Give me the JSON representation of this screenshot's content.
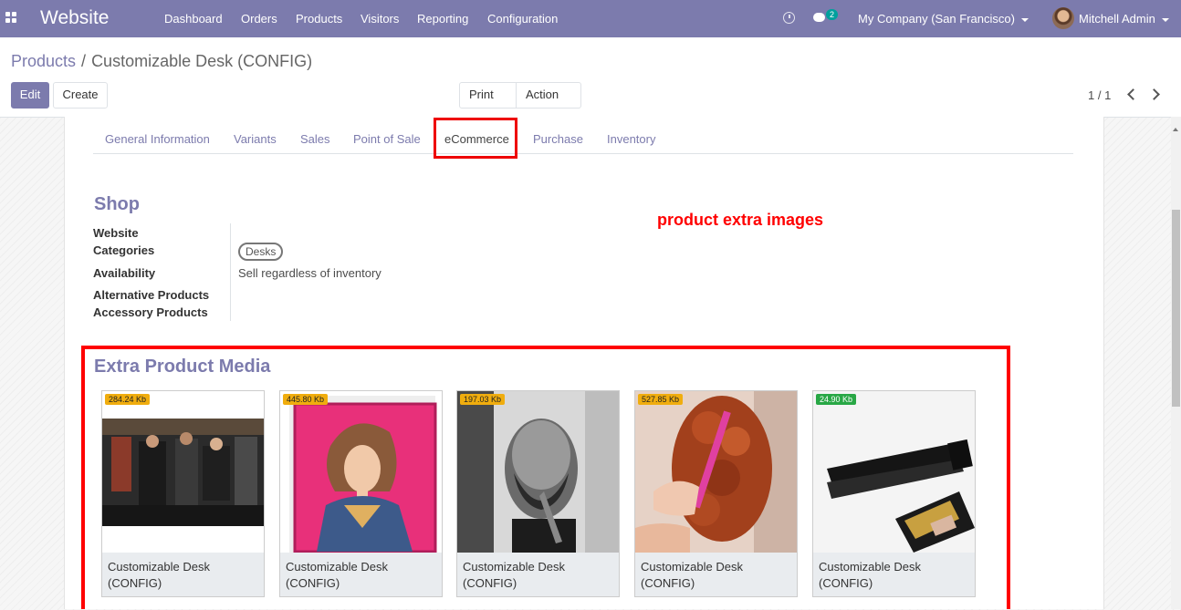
{
  "navbar": {
    "brand": "Website",
    "menu": [
      "Dashboard",
      "Orders",
      "Products",
      "Visitors",
      "Reporting",
      "Configuration"
    ],
    "chat_count": "2",
    "company": "My Company (San Francisco)",
    "user": "Mitchell Admin"
  },
  "breadcrumb": {
    "parent": "Products",
    "separator": "/",
    "current": "Customizable Desk (CONFIG)"
  },
  "buttons": {
    "edit": "Edit",
    "create": "Create",
    "print": "Print",
    "action": "Action"
  },
  "pager": "1 / 1",
  "tabs": [
    "General Information",
    "Variants",
    "Sales",
    "Point of Sale",
    "eCommerce",
    "Purchase",
    "Inventory"
  ],
  "active_tab": "eCommerce",
  "shop": {
    "title": "Shop",
    "fields": {
      "website": "Website",
      "categories": "Categories",
      "categories_tag": "Desks",
      "availability": "Availability",
      "availability_value": "Sell regardless of inventory",
      "alternative": "Alternative Products",
      "accessory": "Accessory Products"
    }
  },
  "annotation": "product extra images",
  "media": {
    "title": "Extra Product Media",
    "items": [
      {
        "size": "284.24 Kb",
        "line1": "Customizable Desk",
        "line2": "(CONFIG)"
      },
      {
        "size": "445.80 Kb",
        "line1": "Customizable Desk",
        "line2": "(CONFIG)"
      },
      {
        "size": "197.03 Kb",
        "line1": "Customizable Desk",
        "line2": "(CONFIG)"
      },
      {
        "size": "527.85 Kb",
        "line1": "Customizable Desk",
        "line2": "(CONFIG)"
      },
      {
        "size": "24.90 Kb",
        "line1": "Customizable Desk",
        "line2": "(CONFIG)"
      }
    ]
  },
  "colors": {
    "brand": "#7c7bad",
    "annotation": "#ff0000",
    "size_badge": "#f0ad0e",
    "size_badge_small": "#28a745"
  }
}
